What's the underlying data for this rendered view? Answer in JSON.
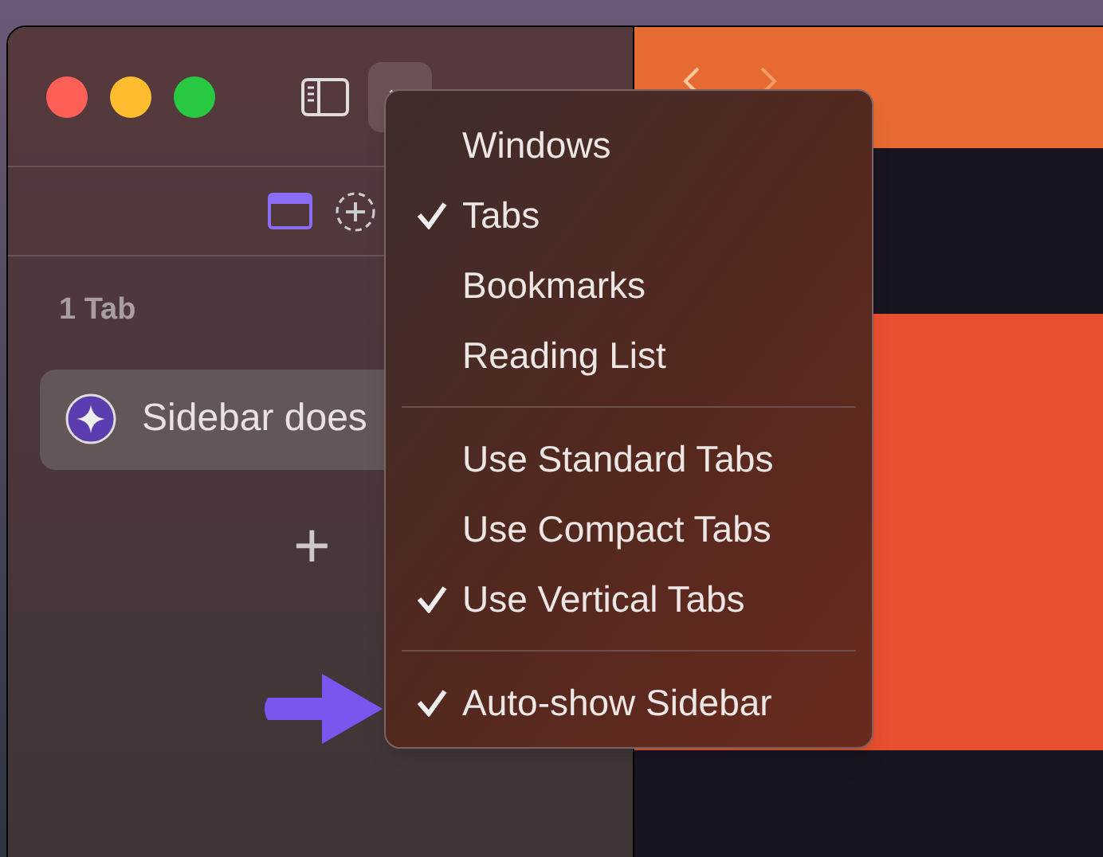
{
  "sidebar": {
    "section_label": "1 Tab",
    "tabs": [
      {
        "title": "Sidebar does",
        "selected": true
      }
    ],
    "new_tab": "+"
  },
  "menu": {
    "groups": [
      [
        {
          "label": "Windows",
          "checked": false
        },
        {
          "label": "Tabs",
          "checked": true
        },
        {
          "label": "Bookmarks",
          "checked": false
        },
        {
          "label": "Reading List",
          "checked": false
        }
      ],
      [
        {
          "label": "Use Standard Tabs",
          "checked": false
        },
        {
          "label": "Use Compact Tabs",
          "checked": false
        },
        {
          "label": "Use Vertical Tabs",
          "checked": true
        }
      ],
      [
        {
          "label": "Auto-show Sidebar",
          "checked": true
        }
      ]
    ]
  }
}
